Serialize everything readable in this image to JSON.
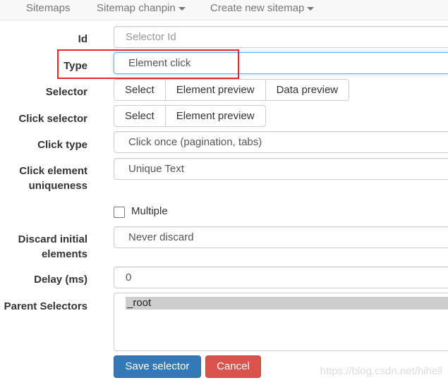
{
  "nav": {
    "sitemaps": "Sitemaps",
    "sitemap_menu": "Sitemap chanpin",
    "create_menu": "Create new sitemap"
  },
  "form": {
    "id": {
      "label": "Id",
      "placeholder": "Selector Id"
    },
    "type": {
      "label": "Type",
      "value": "Element click"
    },
    "selector": {
      "label": "Selector",
      "buttons": [
        "Select",
        "Element preview",
        "Data preview"
      ]
    },
    "click_selector": {
      "label": "Click selector",
      "buttons": [
        "Select",
        "Element preview"
      ]
    },
    "click_type": {
      "label": "Click type",
      "value": "Click once (pagination, tabs)"
    },
    "click_uniqueness": {
      "label_line1": "Click element",
      "label_line2": "uniqueness",
      "value": "Unique Text"
    },
    "multiple": {
      "label": "Multiple",
      "checked": false
    },
    "discard": {
      "label_line1": "Discard initial",
      "label_line2": "elements",
      "value": "Never discard"
    },
    "delay": {
      "label": "Delay (ms)",
      "value": "0"
    },
    "parents": {
      "label": "Parent Selectors",
      "options": [
        "_root"
      ]
    }
  },
  "actions": {
    "save": "Save selector",
    "cancel": "Cancel"
  },
  "watermark": "https://blog.csdn.net/hihell",
  "colors": {
    "primary": "#337ab7",
    "danger": "#d9534f",
    "highlight": "#e8262c",
    "focus": "#66afe9"
  }
}
